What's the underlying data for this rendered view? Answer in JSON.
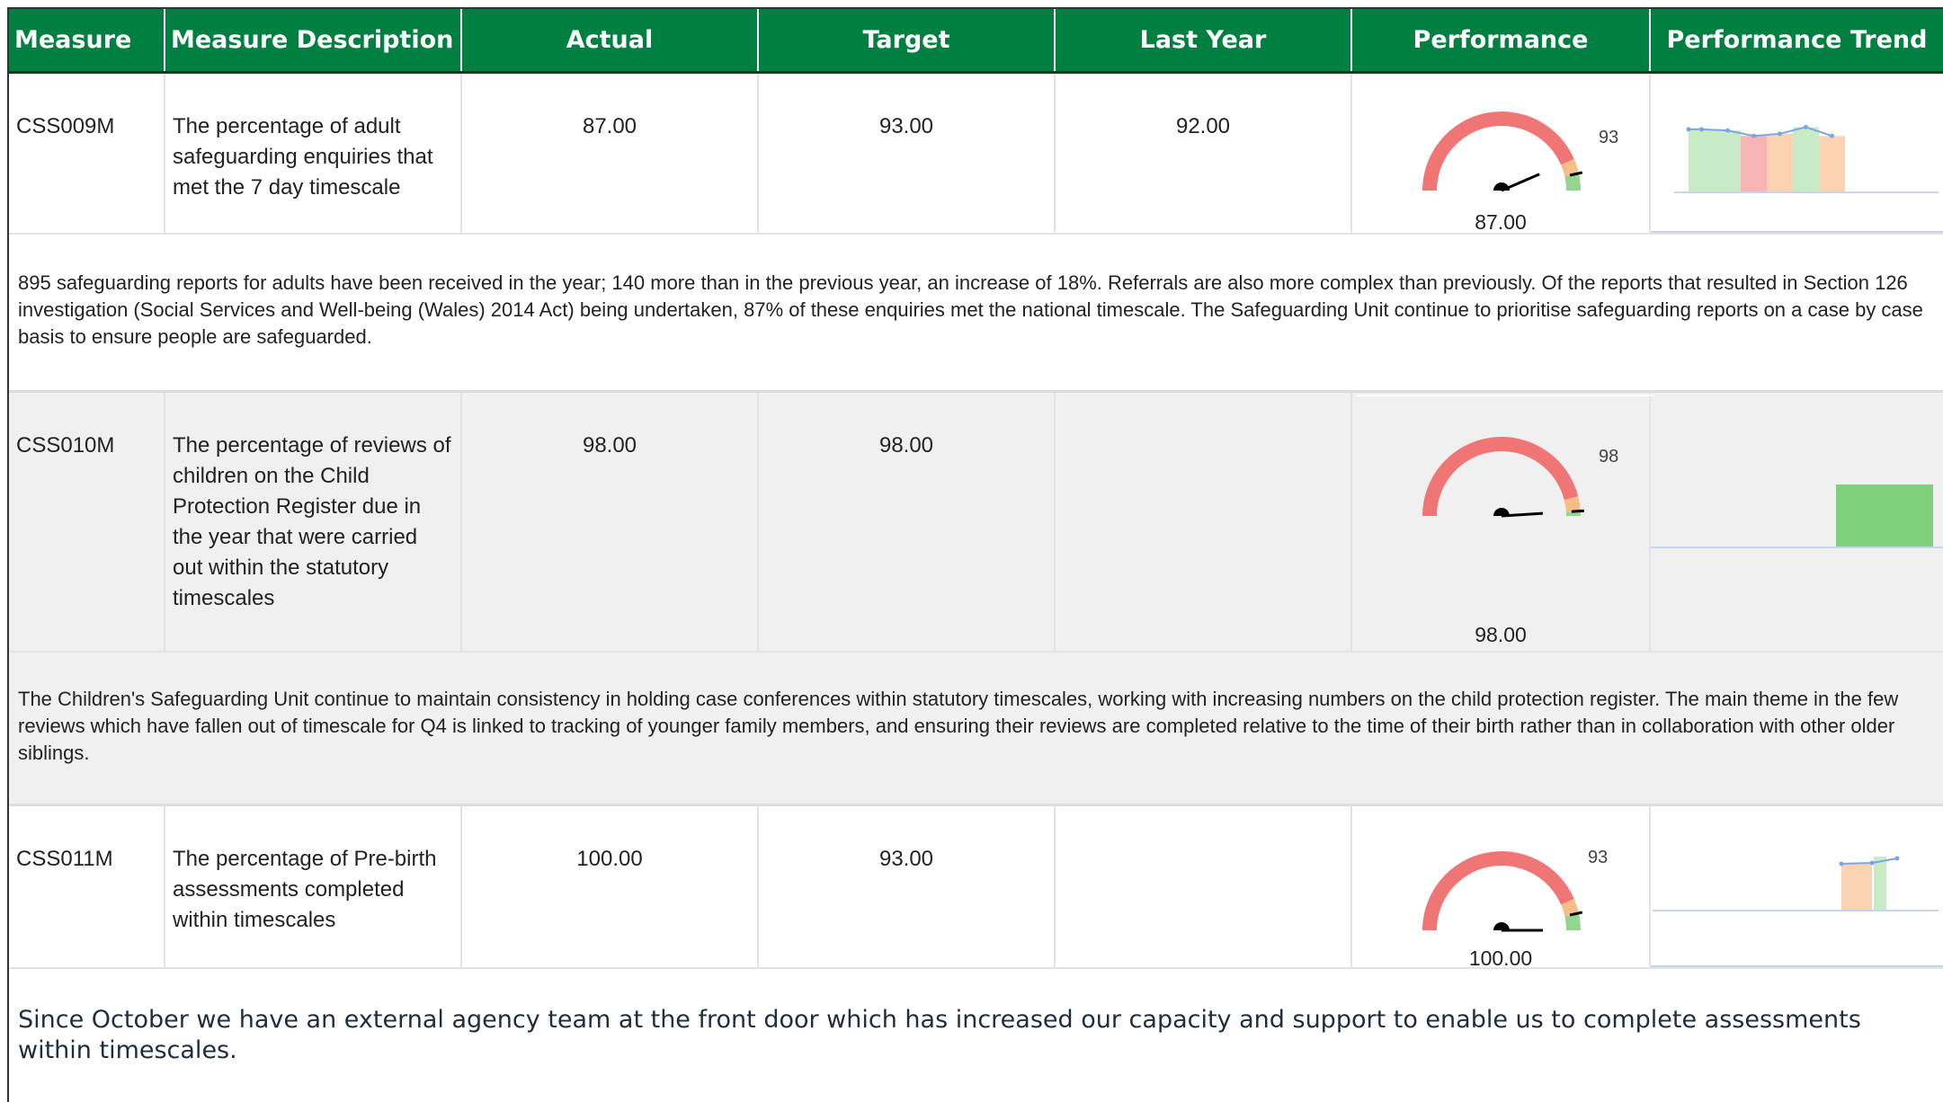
{
  "columns": {
    "measure": "Measure",
    "description": "Measure Description",
    "actual": "Actual",
    "target": "Target",
    "last_year": "Last Year",
    "performance": "Performance",
    "trend": "Performance Trend"
  },
  "colors": {
    "header_bg": "#008040",
    "gauge_red": "#f07575",
    "gauge_amber": "#f7bd86",
    "gauge_green": "#93d48f",
    "trend_green": "#c8ebc6",
    "trend_red": "#f8b4b4",
    "trend_amber": "#fbd3b0",
    "trend_line": "#7aa6e6"
  },
  "rows": [
    {
      "measure": "CSS009M",
      "description": "The percentage of adult safeguarding enquiries that met the 7 day timescale",
      "actual": "87.00",
      "target": "93.00",
      "last_year": "92.00",
      "gauge": {
        "value": 87.0,
        "target": 93,
        "value_label": "87.00",
        "target_label": "93"
      },
      "trend": [
        {
          "status": "green",
          "value": 97
        },
        {
          "status": "green",
          "value": 96
        },
        {
          "status": "red",
          "value": 91
        },
        {
          "status": "amber",
          "value": 93
        },
        {
          "status": "green",
          "value": 99
        },
        {
          "status": "amber",
          "value": 91
        }
      ],
      "commentary": "895 safeguarding reports for adults have been received in the year; 140 more than in the previous year, an increase of 18%. Referrals are also more complex than previously. Of the reports that resulted in Section 126 investigation (Social Services and Well-being (Wales) 2014 Act) being undertaken, 87% of these enquiries met the national timescale. The Safeguarding Unit continue to prioritise safeguarding reports on a case by case basis to ensure people are safeguarded."
    },
    {
      "measure": "CSS010M",
      "description": "The percentage of reviews of children on the Child Protection Register due in the year that were carried out within the statutory timescales",
      "actual": "98.00",
      "target": "98.00",
      "last_year": "",
      "gauge": {
        "value": 98.0,
        "target": 98,
        "value_label": "98.00",
        "target_label": "98"
      },
      "trend": [
        {
          "status": "green",
          "value": 98
        }
      ],
      "commentary": "The Children's Safeguarding Unit continue to maintain consistency in holding case conferences within statutory timescales, working with increasing numbers on the child protection register. The main theme in the few reviews which have fallen out of timescale for Q4 is linked to tracking of younger family members, and ensuring their reviews are completed relative to the time of their birth rather than in collaboration with other older siblings."
    },
    {
      "measure": "CSS011M",
      "description": "The percentage of Pre-birth assessments completed within timescales",
      "actual": "100.00",
      "target": "93.00",
      "last_year": "",
      "gauge": {
        "value": 100.0,
        "target": 93,
        "value_label": "100.00",
        "target_label": "93"
      },
      "trend": [
        {
          "status": "amber",
          "value": 92
        },
        {
          "status": "green",
          "value": 100
        }
      ],
      "commentary": "Since October we have an external agency team at the front door which has increased our capacity and support to enable us to complete assessments within timescales."
    }
  ]
}
